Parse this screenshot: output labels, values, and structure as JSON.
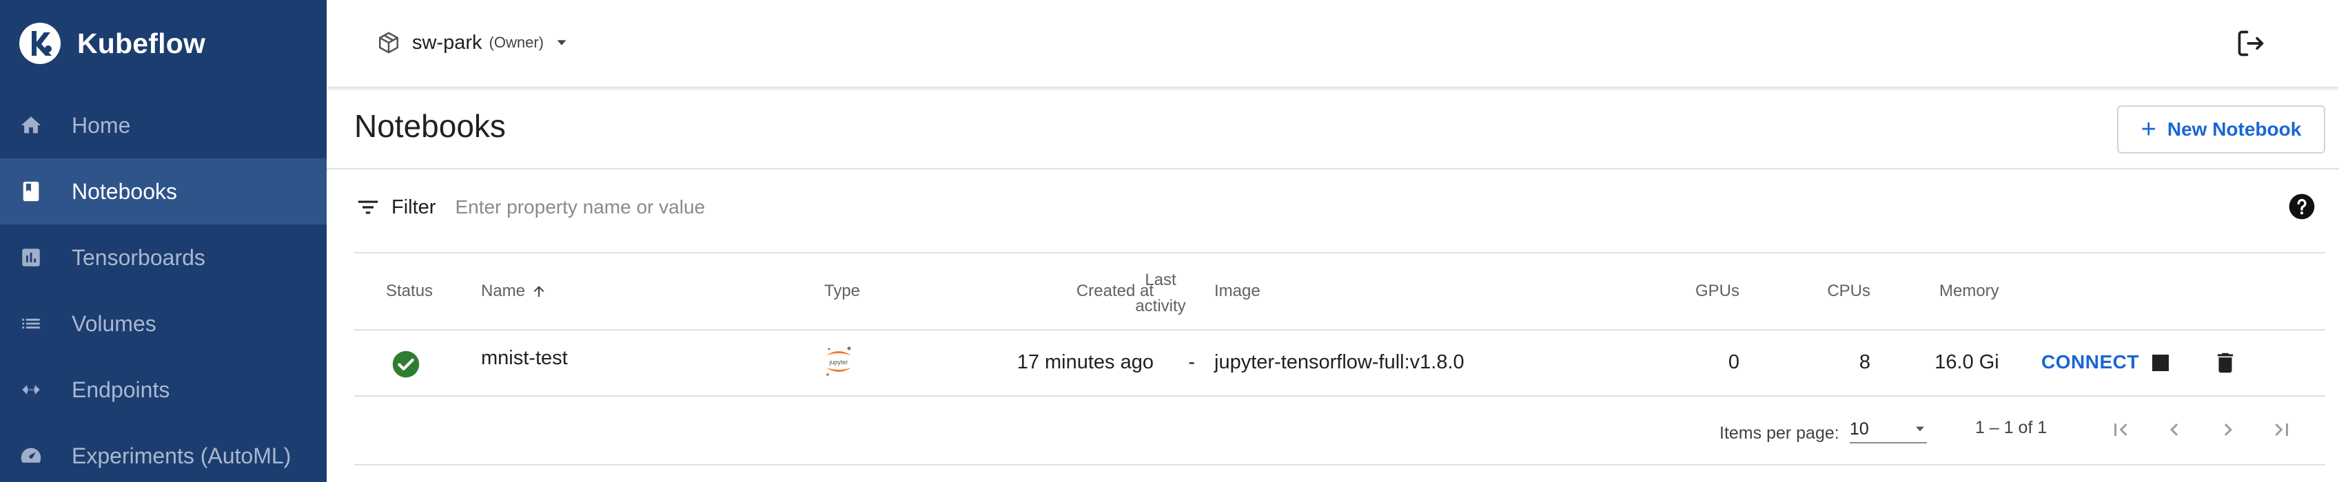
{
  "brand": {
    "name": "Kubeflow",
    "logo_icon": "kubeflow-logo"
  },
  "sidebar": {
    "items": [
      {
        "label": "Home",
        "icon": "home-icon",
        "active": false
      },
      {
        "label": "Notebooks",
        "icon": "notebook-icon",
        "active": true
      },
      {
        "label": "Tensorboards",
        "icon": "chart-icon",
        "active": false
      },
      {
        "label": "Volumes",
        "icon": "list-icon",
        "active": false
      },
      {
        "label": "Endpoints",
        "icon": "arrows-icon",
        "active": false
      },
      {
        "label": "Experiments (AutoML)",
        "icon": "speed-icon",
        "active": false
      }
    ]
  },
  "topbar": {
    "namespace": "sw-park",
    "role": "(Owner)"
  },
  "page": {
    "title": "Notebooks",
    "new_button": "New Notebook"
  },
  "filter": {
    "label": "Filter",
    "placeholder": "Enter property name or value"
  },
  "table": {
    "headers": {
      "status": "Status",
      "name": "Name",
      "type": "Type",
      "created": "Created at",
      "last_activity_1": "Last",
      "last_activity_2": "activity",
      "image": "Image",
      "gpus": "GPUs",
      "cpus": "CPUs",
      "memory": "Memory"
    },
    "rows": [
      {
        "status": "running",
        "name": "mnist-test",
        "type": "jupyter",
        "created": "17 minutes ago",
        "last_activity": "-",
        "image": "jupyter-tensorflow-full:v1.8.0",
        "gpus": "0",
        "cpus": "8",
        "memory": "16.0 Gi",
        "connect": "CONNECT"
      }
    ]
  },
  "paginator": {
    "items_per_page_label": "Items per page:",
    "page_size": "10",
    "range": "1 – 1 of 1"
  },
  "colors": {
    "sidebar_bg": "#1c3d70",
    "sidebar_active": "#2f5489",
    "accent": "#1a66d2",
    "status_ok": "#2e7d32",
    "jupyter_orange": "#f37726"
  }
}
